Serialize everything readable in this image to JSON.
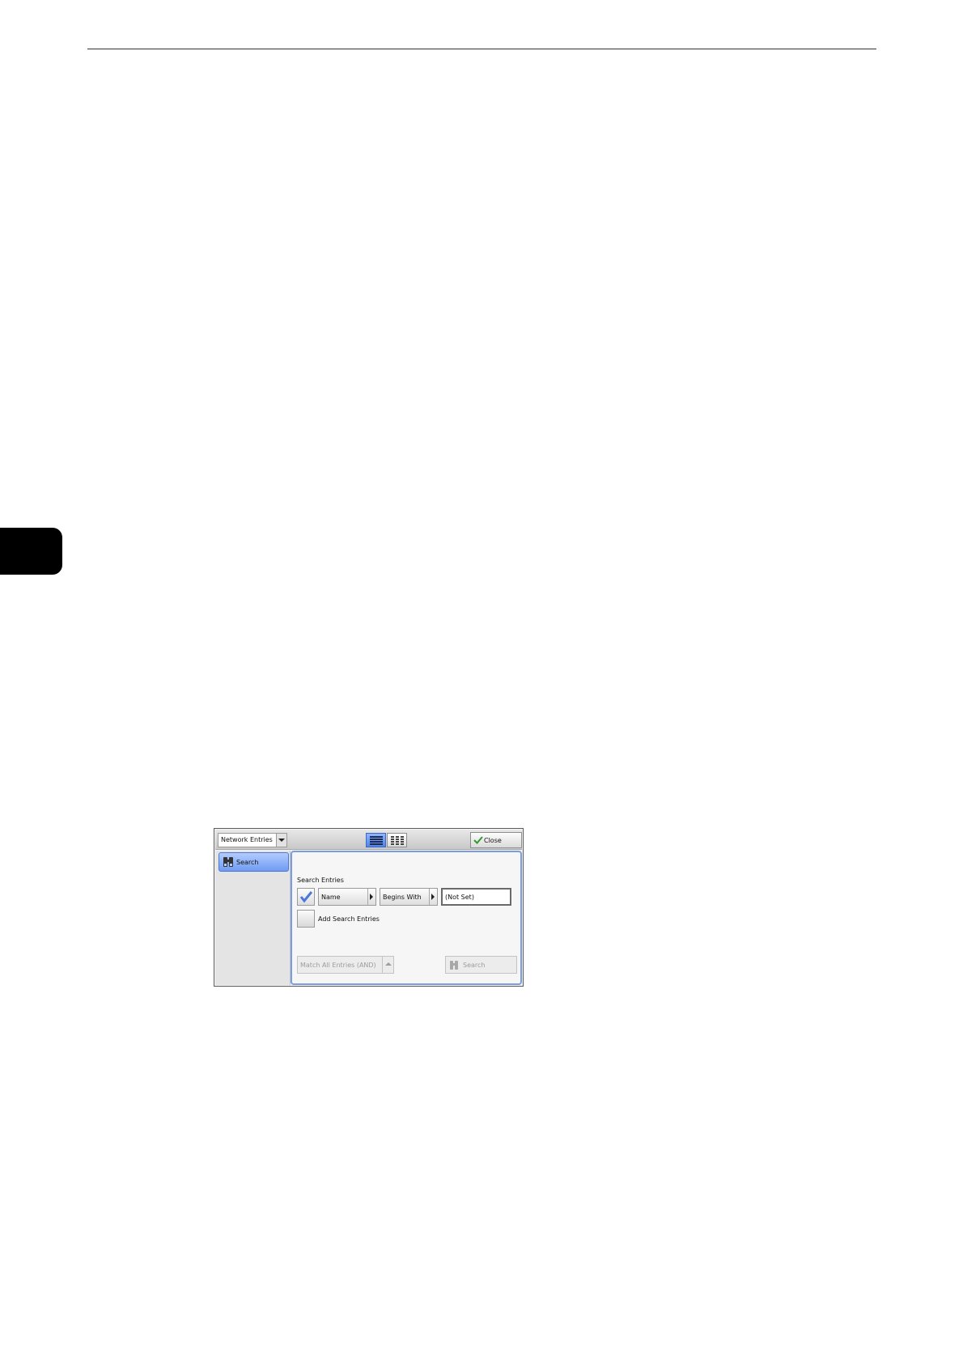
{
  "toolbar": {
    "dropdown_value": "Network Entries",
    "close_label": "Close"
  },
  "sidebar": {
    "items": [
      {
        "label": "Search",
        "selected": true
      }
    ]
  },
  "panel": {
    "section_label": "Search Entries",
    "criteria": {
      "field": "Name",
      "condition": "Begins With",
      "value": "(Not Set)",
      "checked": true
    },
    "add_entries_label": "Add Search Entries",
    "match_label": "Match All Entries (AND)",
    "search_label": "Search"
  },
  "icons": {
    "view_list": "list-view-icon",
    "view_grid": "grid-view-icon",
    "close": "checkmark-icon",
    "search": "binoculars-icon",
    "check": "checkmark-icon"
  },
  "colors": {
    "accent": "#6e9bf1",
    "panel_border": "#7a9de0",
    "chapter_tab": "#000000"
  }
}
